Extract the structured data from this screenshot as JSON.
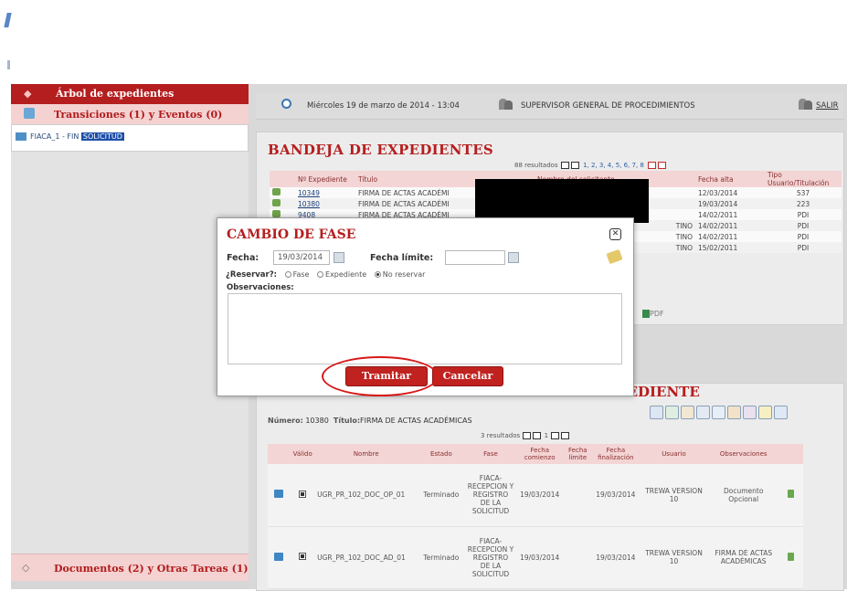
{
  "sidebar": {
    "arbol_label": "Árbol de expedientes",
    "transiciones_label": "Transiciones (1) y Eventos (0)",
    "item_prefix": "FIACA_1 - FIN",
    "item_highlight": "SOLICITUD",
    "documentos_label": "Documentos (2) y Otras Tareas (1)"
  },
  "status": {
    "datetime": "Miércoles 19 de marzo de 2014 - 13:04",
    "user_role": "SUPERVISOR GENERAL DE PROCEDIMIENTOS",
    "salir": "SALIR"
  },
  "bandeja": {
    "title": "BANDEJA DE EXPEDIENTES",
    "results": "88 resultados",
    "pages": "1, 2, 3, 4, 5, 6, 7, 8",
    "columns": [
      "Nº Expediente",
      "Título",
      "Nombre del solicitante",
      "Fecha alta",
      "Tipo Usuario/Titulación"
    ],
    "rows": [
      {
        "num": "10349",
        "titulo": "FIRMA DE ACTAS ACADÉMI",
        "estado": "",
        "fecha": "12/03/2014",
        "tipo": "537"
      },
      {
        "num": "10380",
        "titulo": "FIRMA DE ACTAS ACADÉMI",
        "estado": "",
        "fecha": "19/03/2014",
        "tipo": "223"
      },
      {
        "num": "9408",
        "titulo": "FIRMA DE ACTAS ACADÉMI",
        "estado": "",
        "fecha": "14/02/2011",
        "tipo": "PDI"
      },
      {
        "num": "",
        "titulo": "",
        "estado": "TINO",
        "fecha": "14/02/2011",
        "tipo": "PDI"
      },
      {
        "num": "",
        "titulo": "",
        "estado": "TINO",
        "fecha": "14/02/2011",
        "tipo": "PDI"
      },
      {
        "num": "",
        "titulo": "",
        "estado": "TINO",
        "fecha": "15/02/2011",
        "tipo": "PDI"
      }
    ],
    "pdf": "PDF"
  },
  "docs": {
    "title": "DOCUMENTOS Y OTRAS TAREAS DEL EXPEDIENTE",
    "numero_label": "Número:",
    "numero_value": "10380",
    "titulo_label": "Título:",
    "titulo_value": "FIRMA DE ACTAS ACADÉMICAS",
    "results": "3 resultados",
    "page": "1",
    "columns": [
      "Válido",
      "Nombre",
      "Estado",
      "Fase",
      "Fecha comienzo",
      "Fecha límite",
      "Fecha finalización",
      "Usuario",
      "Observaciones"
    ],
    "rows": [
      {
        "nombre": "UGR_PR_102_DOC_OP_01",
        "estado": "Terminado",
        "fase": "FIACA-RECEPCION Y REGISTRO DE LA SOLICITUD",
        "inicio": "19/03/2014",
        "limite": "",
        "fin": "19/03/2014",
        "usuario": "TREWA VERSION 10",
        "obs": "Documento Opcional"
      },
      {
        "nombre": "UGR_PR_102_DOC_AD_01",
        "estado": "Terminado",
        "fase": "FIACA-RECEPCION Y REGISTRO DE LA SOLICITUD",
        "inicio": "19/03/2014",
        "limite": "",
        "fin": "19/03/2014",
        "usuario": "TREWA VERSION 10",
        "obs": "FIRMA DE ACTAS ACADÉMICAS"
      }
    ]
  },
  "modal": {
    "title": "CAMBIO DE FASE",
    "fecha_label": "Fecha:",
    "fecha_value": "19/03/2014",
    "fecha_limite_label": "Fecha límite:",
    "fecha_limite_value": "",
    "reservar_label": "¿Reservar?:",
    "opt_fase": "Fase",
    "opt_expediente": "Expediente",
    "opt_no_reservar": "No reservar",
    "selected_option": "No reservar",
    "observaciones_label": "Observaciones:",
    "tramitar": "Tramitar",
    "cancelar": "Cancelar"
  },
  "colors": {
    "brand_red": "#b51e1e",
    "header_pink": "#f3d5d5",
    "highlight_blue": "#1d4fa8",
    "annotation_red": "#d81818"
  }
}
